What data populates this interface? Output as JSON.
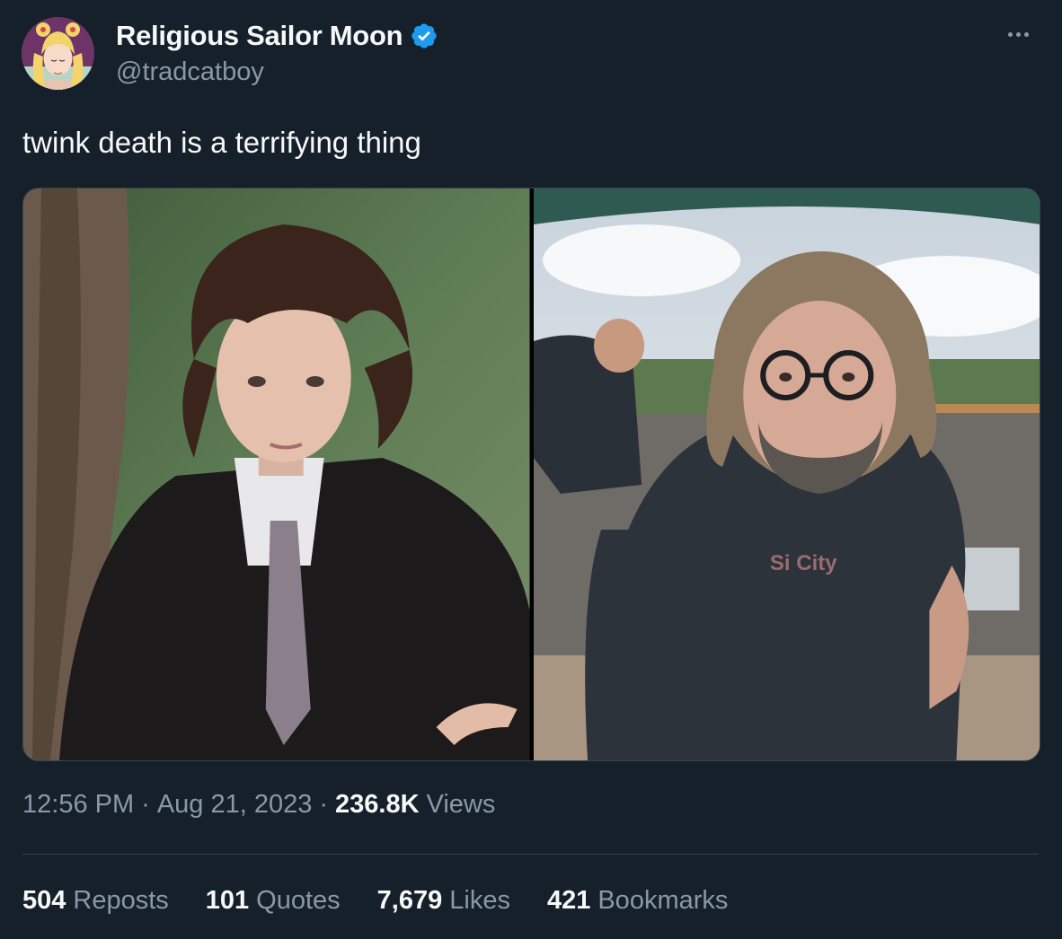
{
  "author": {
    "display_name": "Religious Sailor Moon",
    "handle": "@tradcatboy",
    "verified": true,
    "avatar_icon": "sailor-moon-avatar",
    "verified_color": "#1d9bf0"
  },
  "tweet": {
    "text": "twink death is a terrifying thing",
    "time": "12:56 PM",
    "date": "Aug 21, 2023",
    "views_count": "236.8K",
    "views_label": "Views",
    "separator": "·"
  },
  "media": {
    "count": 2,
    "photos": [
      {
        "description_icon": "young-man-in-suit-photo"
      },
      {
        "description_icon": "bearded-man-with-glasses-photo",
        "shirt_text": "Si City"
      }
    ]
  },
  "stats": [
    {
      "count": "504",
      "label": "Reposts"
    },
    {
      "count": "101",
      "label": "Quotes"
    },
    {
      "count": "7,679",
      "label": "Likes"
    },
    {
      "count": "421",
      "label": "Bookmarks"
    }
  ],
  "colors": {
    "background": "#15202b",
    "text_primary": "#f7f9f9",
    "text_secondary": "#8b98a5",
    "divider": "#38444d"
  }
}
